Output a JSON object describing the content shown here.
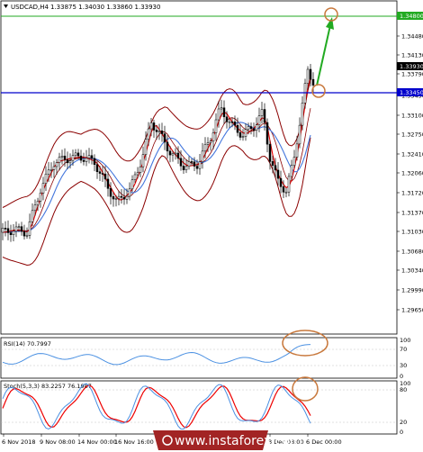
{
  "header": {
    "symbol": "USDCAD,H4",
    "ohlc": "1.33875 1.34030 1.33860 1.33930"
  },
  "price_axis": {
    "ticks": [
      "1.34480",
      "1.34130",
      "1.33790",
      "1.33450",
      "1.33100",
      "1.32750",
      "1.32410",
      "1.32060",
      "1.31720",
      "1.31370",
      "1.31030",
      "1.30680",
      "1.30340",
      "1.29990",
      "1.29650"
    ],
    "current_price_label": "1.33930",
    "green_level_label": "1.34800",
    "blue_level_label": "1.33450"
  },
  "rsi": {
    "title": "RSI(14) 70.7997",
    "scale": [
      "100",
      "70",
      "30",
      "0"
    ]
  },
  "stoch": {
    "title": "Stoch(5,3,3) 83.2257 76.1987",
    "scale": [
      "100",
      "80",
      "20",
      "0"
    ]
  },
  "time_axis": {
    "labels": [
      "6 Nov 2018",
      "9 Nov 08:00",
      "14 Nov 00:00",
      "16 Nov 16:00",
      "3 Dec 08:00",
      "6 Dec 00:00"
    ]
  },
  "watermark": "www.instaforex.com",
  "colors": {
    "green_line": "#22aa22",
    "blue_line": "#0000cc",
    "bollinger": "#8b0000",
    "ma_red": "#ee0000",
    "ma_blue": "#4477dd",
    "rsi": "#4a90e2",
    "annotation_circle": "#c8783c",
    "candle": "#000000"
  }
}
